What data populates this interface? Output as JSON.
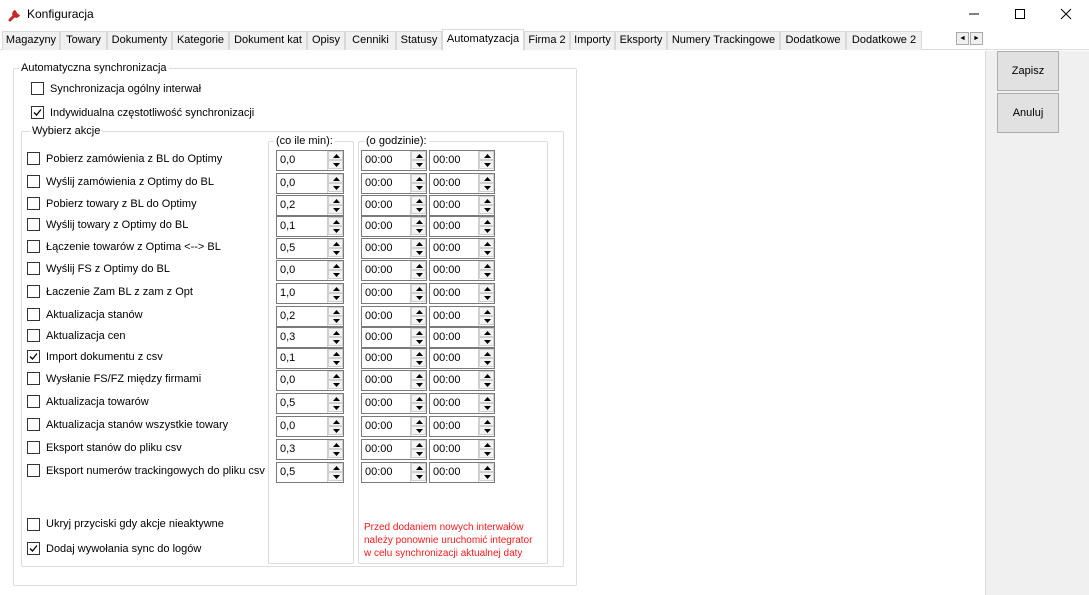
{
  "window": {
    "title": "Konfiguracja",
    "controls": [
      "minimize-icon",
      "maximize-icon",
      "close-icon"
    ]
  },
  "tabs": [
    {
      "label": "Magazyny"
    },
    {
      "label": "Towary"
    },
    {
      "label": "Dokumenty"
    },
    {
      "label": "Kategorie"
    },
    {
      "label": "Dokument kat"
    },
    {
      "label": "Opisy"
    },
    {
      "label": "Cenniki"
    },
    {
      "label": "Statusy"
    },
    {
      "label": "Automatyzacja",
      "active": true
    },
    {
      "label": "Firma 2"
    },
    {
      "label": "Importy"
    },
    {
      "label": "Eksporty"
    },
    {
      "label": "Numery Trackingowe"
    },
    {
      "label": "Dodatkowe"
    },
    {
      "label": "Dodatkowe 2"
    }
  ],
  "tab_scroll": {
    "left_icon": "arrow-left-icon",
    "right_icon": "arrow-right-icon",
    "left_glyph": "◄",
    "right_glyph": "►"
  },
  "buttons": {
    "save": "Zapisz",
    "cancel": "Anuluj"
  },
  "sync_group": {
    "title": "Automatyczna synchronizacja",
    "general_interval": {
      "label": "Synchronizacja ogólny interwał",
      "checked": false
    },
    "individual_frequency": {
      "label": "Indywidualna częstotliwość synchronizacji",
      "checked": true
    }
  },
  "actions_group": {
    "title": "Wybierz akcje",
    "interval_header": "(co ile min):",
    "time_header": "(o godzinie):",
    "actions": [
      {
        "label": "Pobierz zamówienia z BL do Optimy",
        "checked": false,
        "interval": "0,0",
        "time_from": "00:00",
        "time_to": "00:00"
      },
      {
        "label": "Wyślij zamówienia z Optimy do BL",
        "checked": false,
        "interval": "0,0",
        "time_from": "00:00",
        "time_to": "00:00"
      },
      {
        "label": "Pobierz towary z BL do Optimy",
        "checked": false,
        "interval": "0,2",
        "time_from": "00:00",
        "time_to": "00:00"
      },
      {
        "label": "Wyślij towary z Optimy do BL",
        "checked": false,
        "interval": "0,1",
        "time_from": "00:00",
        "time_to": "00:00"
      },
      {
        "label": "Łączenie towarów z Optima <--> BL",
        "checked": false,
        "interval": "0,5",
        "time_from": "00:00",
        "time_to": "00:00"
      },
      {
        "label": "Wyślij FS z Optimy do BL",
        "checked": false,
        "interval": "0,0",
        "time_from": "00:00",
        "time_to": "00:00"
      },
      {
        "label": "Łaczenie Zam BL z zam z Opt",
        "checked": false,
        "interval": "1,0",
        "time_from": "00:00",
        "time_to": "00:00"
      },
      {
        "label": "Aktualizacja stanów",
        "checked": false,
        "interval": "0,2",
        "time_from": "00:00",
        "time_to": "00:00"
      },
      {
        "label": "Aktualizacja cen",
        "checked": false,
        "interval": "0,3",
        "time_from": "00:00",
        "time_to": "00:00"
      },
      {
        "label": "Import dokumentu z csv",
        "checked": true,
        "interval": "0,1",
        "time_from": "00:00",
        "time_to": "00:00"
      },
      {
        "label": "Wysłanie FS/FZ między firmami",
        "checked": false,
        "interval": "0,0",
        "time_from": "00:00",
        "time_to": "00:00"
      },
      {
        "label": "Aktualizacja towarów",
        "checked": false,
        "interval": "0,5",
        "time_from": "00:00",
        "time_to": "00:00"
      },
      {
        "label": "Aktualizacja stanów wszystkie towary",
        "checked": false,
        "interval": "0,0",
        "time_from": "00:00",
        "time_to": "00:00"
      },
      {
        "label": "Eksport stanów do pliku csv",
        "checked": false,
        "interval": "0,3",
        "time_from": "00:00",
        "time_to": "00:00"
      },
      {
        "label": "Eksport numerów trackingowych do pliku csv",
        "checked": false,
        "interval": "0,5",
        "time_from": "00:00",
        "time_to": "00:00"
      }
    ],
    "hide_buttons": {
      "label": "Ukryj przyciski gdy akcje nieaktywne",
      "checked": false
    },
    "add_sync_logs": {
      "label": "Dodaj wywołania sync do logów",
      "checked": true
    },
    "note_lines": [
      "Przed dodaniem nowych interwałów",
      "należy ponownie uruchomić integrator",
      "w celu synchronizacji aktualnej daty"
    ]
  },
  "colors": {
    "note_text": "#ff1a1a",
    "panel_bg": "#f0f0f0",
    "button_bg": "#e1e1e1",
    "title_icon": "#c62828"
  }
}
